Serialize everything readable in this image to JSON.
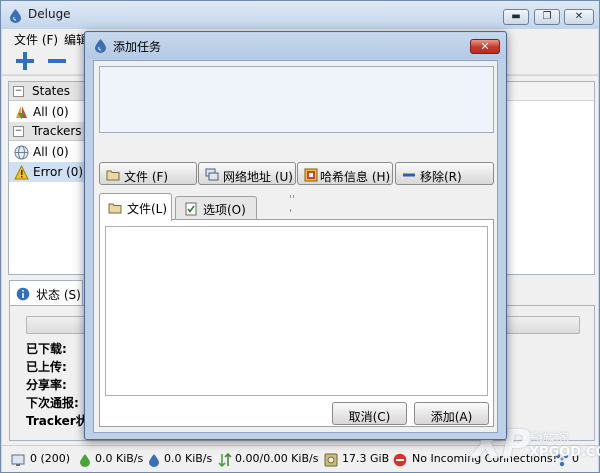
{
  "app": {
    "title": "Deluge",
    "window_buttons": {
      "minimize": "▬",
      "maximize": "❐",
      "close": "✕"
    }
  },
  "menu": [
    "文件 (F)",
    "编辑"
  ],
  "toolbar": {
    "icons": [
      "add-icon",
      "remove-icon"
    ]
  },
  "sidebar": {
    "states_header": "States",
    "states_items": [
      {
        "label": "All (0)",
        "icon": "all-states-icon"
      }
    ],
    "trackers_header": "Trackers",
    "trackers_items": [
      {
        "label": "All (0)",
        "icon": "globe-icon"
      },
      {
        "label": "Error (0)",
        "icon": "warning-icon"
      }
    ]
  },
  "details": {
    "tab_label": "状态 (S)",
    "progress": 0,
    "labels": [
      "已下载:",
      "已上传:",
      "分享率:",
      "下次通报:",
      "Tracker状态"
    ]
  },
  "statusbar": {
    "connections": "0 (200)",
    "download_speed": "0.0 KiB/s",
    "upload_speed": "0.0 KiB/s",
    "protocol": "0.00/0.00 KiB/s",
    "free_space": "17.3 GiB",
    "incoming": "No Incoming Connections!",
    "dht": "0"
  },
  "watermark": {
    "brand": "XP",
    "chinese": "系统之家",
    "url": "XPGOD.COM"
  },
  "dialog": {
    "title": "添加任务",
    "buttons": {
      "file": "文件 (F)",
      "url": "网络地址 (U)",
      "infohash": "哈希信息 (H)",
      "remove": "移除(R)"
    },
    "tabs": {
      "files": "文件(L)",
      "options": "选项(O)"
    },
    "cancel": "取消(C)",
    "add": "添加(A)"
  },
  "colors": {
    "title_bar": "#c4d5ea",
    "dialog_frame": "#bdd0e8",
    "selection": "#cfe0f5",
    "close_red": "#c4392a"
  }
}
